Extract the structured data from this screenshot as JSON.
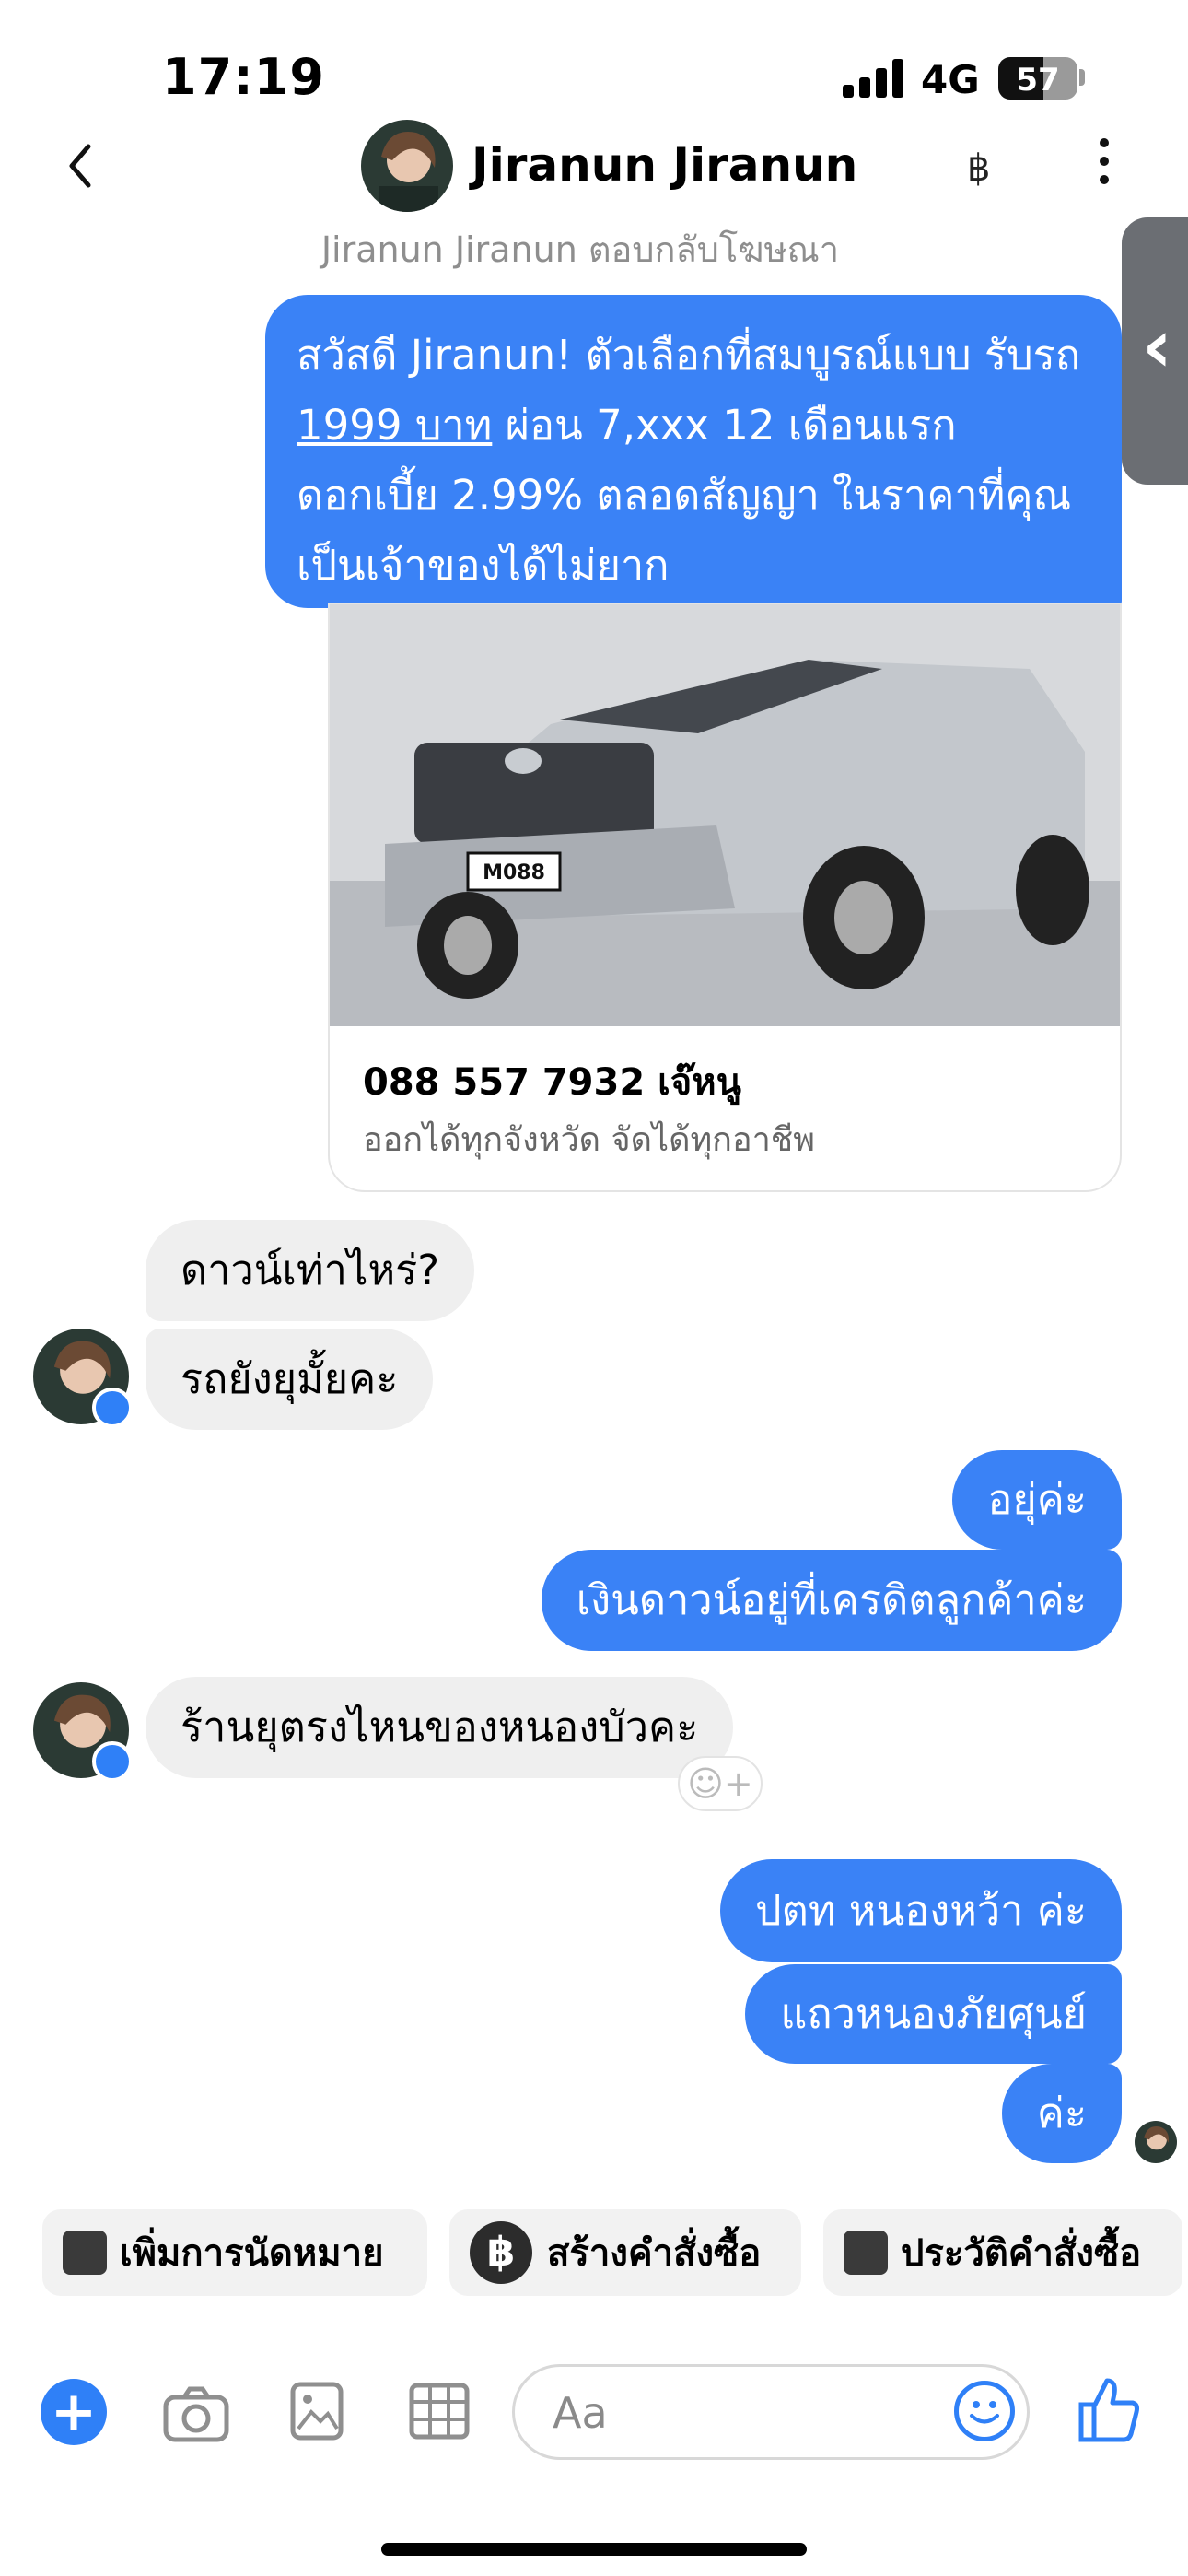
{
  "status": {
    "time": "17:19",
    "network": "4G",
    "battery": "57"
  },
  "header": {
    "name": "Jiranun Jiranun",
    "subtitle": "Jiranun Jiranun ตอบกลับโฆษณา",
    "currency_icon": "฿"
  },
  "ad_message": {
    "text_before": "สวัสดี Jiranun! ตัวเลือกที่สมบูรณ์แบบ รับรถ ",
    "underlined": "1999 บาท",
    "text_after": " ผ่อน 7,xxx 12 เดือนแรก ดอกเบี้ย 2.99% ตลอดสัญญา ในราคาที่คุณเป็นเจ้าของได้ไม่ยาก",
    "card_title": "088 557 7932 เจ๊หนู",
    "card_subtitle": "ออกได้ทุกจังหวัด จัดได้ทุกอาชีพ",
    "plate": "M088"
  },
  "messages": {
    "in1": "ดาวน์เท่าไหร่?",
    "in2": "รถยังยุมั้ยคะ",
    "out1": "อยุ่ค่ะ",
    "out2": "เงินดาวน์อยู่ที่เครดิตลูกค้าค่ะ",
    "in3": "ร้านยุตรงไหนของหนองบัวคะ",
    "out3": "ปตท หนองหว้า ค่ะ",
    "out4": "แถวหนองภัยศุนย์",
    "out5": "ค่ะ"
  },
  "actions": {
    "appointment": "เพิ่มการนัดหมาย",
    "create_order": "สร้างคำสั่งซื้อ",
    "order_history": "ประวัติคำสั่งซื้อ",
    "order_icon": "฿"
  },
  "composer": {
    "placeholder": "Aa"
  },
  "colors": {
    "accent": "#3a82f6",
    "incoming": "#efefef"
  },
  "icons": [
    "back-icon",
    "more-icon",
    "plus-icon",
    "camera-icon",
    "gallery-icon",
    "table-icon",
    "emoji-icon",
    "like-icon",
    "messenger-icon",
    "add-reaction-icon"
  ]
}
